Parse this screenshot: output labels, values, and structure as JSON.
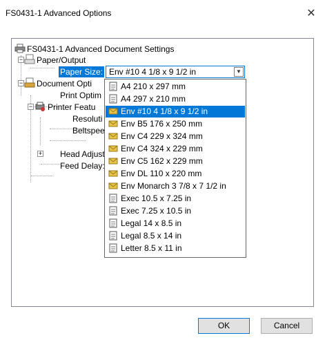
{
  "window": {
    "title": "FS0431-1 Advanced Options",
    "close": "✕"
  },
  "tree": {
    "root": "FS0431-1 Advanced Document Settings",
    "paper_output": "Paper/Output",
    "paper_size_label": "Paper Size:",
    "document_options": "Document Opti",
    "print_optim": "Print Optim",
    "printer_features": "Printer Featu",
    "resolution": "Resoluti",
    "beltspeed": "Beltspee",
    "head_adjust": "Head Adjust",
    "feed_delay": "Feed Delay:"
  },
  "paper_size": {
    "selected": "Env #10 4 1/8 x 9 1/2 in",
    "options": [
      {
        "label": "A4 210 x 297 mm",
        "icon": "page-icon"
      },
      {
        "label": "A4 297 x 210 mm",
        "icon": "page-icon"
      },
      {
        "label": "Env #10 4 1/8 x 9 1/2 in",
        "icon": "envelope-icon"
      },
      {
        "label": "Env B5 176 x 250 mm",
        "icon": "envelope-icon"
      },
      {
        "label": "Env C4 229 x 324 mm",
        "icon": "envelope-icon"
      },
      {
        "label": "Env C4 324 x 229 mm",
        "icon": "envelope-icon"
      },
      {
        "label": "Env C5 162 x 229 mm",
        "icon": "envelope-icon"
      },
      {
        "label": "Env DL 110 x 220 mm",
        "icon": "envelope-icon"
      },
      {
        "label": "Env Monarch 3 7/8 x 7 1/2 in",
        "icon": "envelope-icon"
      },
      {
        "label": "Exec 10.5 x 7.25 in",
        "icon": "page-icon"
      },
      {
        "label": "Exec 7.25 x 10.5 in",
        "icon": "page-icon"
      },
      {
        "label": "Legal 14 x 8.5 in",
        "icon": "page-icon"
      },
      {
        "label": "Legal 8.5 x 14 in",
        "icon": "page-icon"
      },
      {
        "label": "Letter 8.5 x 11 in",
        "icon": "page-icon"
      }
    ],
    "selected_index": 2
  },
  "buttons": {
    "ok": "OK",
    "cancel": "Cancel"
  },
  "colors": {
    "selection": "#0078d7",
    "envelope": "#e8c34a"
  }
}
